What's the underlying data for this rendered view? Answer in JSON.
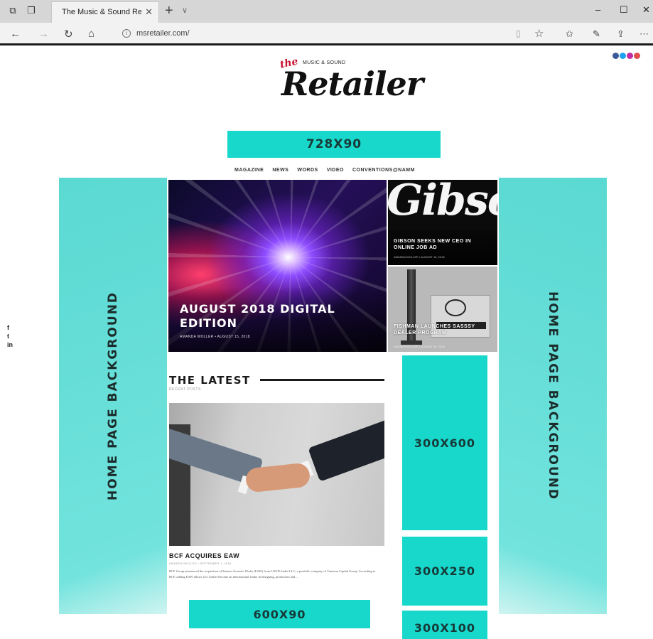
{
  "browser": {
    "tab_title": "The Music & Sound Ret",
    "url": "msretailer.com/"
  },
  "logo": {
    "the": "the",
    "subtitle": "MUSIC & SOUND",
    "name": "Retailer"
  },
  "ads": {
    "top": "728X90",
    "side_tall": "300X600",
    "side_medium": "300X250",
    "side_small": "300X100",
    "bottom": "600X90"
  },
  "background_panels": {
    "left": "HOME PAGE BACKGROUND",
    "right": "HOME PAGE BACKGROUND"
  },
  "nav": {
    "items": [
      "MAGAZINE",
      "NEWS",
      "WORDS",
      "VIDEO",
      "CONVENTIONS@NAMM"
    ]
  },
  "social_left": {
    "items": [
      "f",
      "t",
      "in"
    ]
  },
  "colors": {
    "ad_accent": "#18d8cc",
    "background_panel": "#67e1db"
  },
  "featured": {
    "title": "AUGUST 2018 DIGITAL EDITION",
    "byline": "AMANDA WOLLER • AUGUST 15, 2018"
  },
  "side_stories": [
    {
      "image_text": "Gibson",
      "title": "GIBSON SEEKS NEW CEO IN ONLINE JOB AD",
      "byline": "AMANDA WOLLER • AUGUST 15, 2018"
    },
    {
      "title": "FISHMAN LAUNCHES SASSSY DEALER PROGRAM",
      "byline": "AMANDA WOLLER • AUGUST 15, 2018"
    }
  ],
  "latest": {
    "heading": "THE LATEST",
    "subheading": "RECENT POSTS",
    "story": {
      "title": "BCF ACQUIRES EAW",
      "byline": "AMANDA WOLLER • SEPTEMBER 1, 2018",
      "excerpt": "BCF Group announced the acquisition of Eastern Acoustic Works (EAW) from LOUD Audio LLC, a portfolio company of Transom Capital Group. According to BCF, adding EAW allows it to further become an international leader in designing, production and ..."
    }
  }
}
